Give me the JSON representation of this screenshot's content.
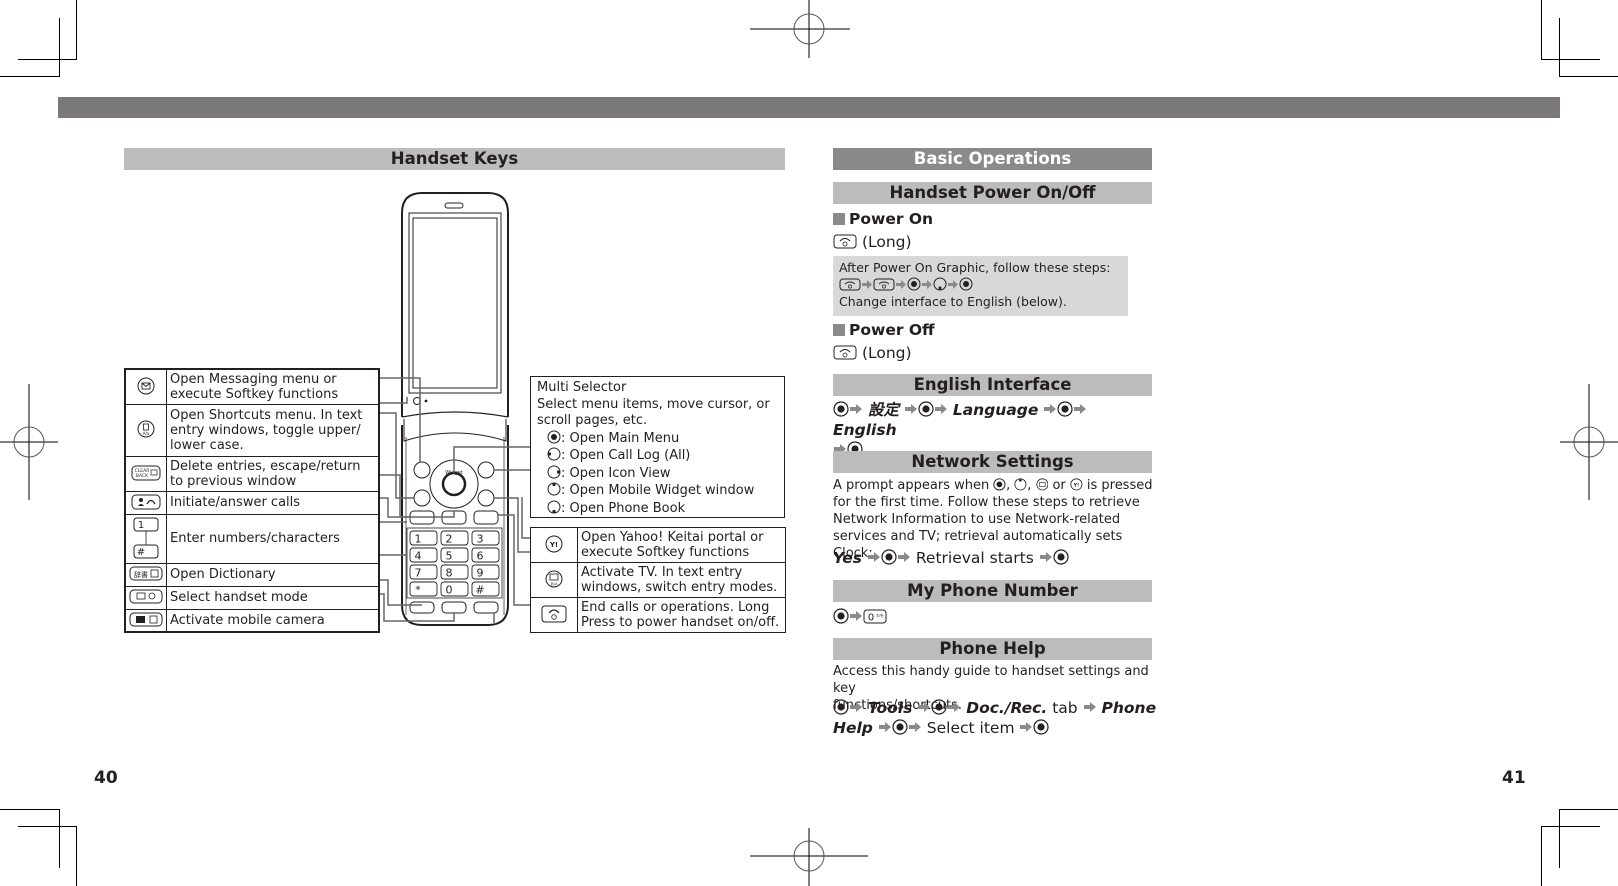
{
  "page_numbers": {
    "left": "40",
    "right": "41"
  },
  "left_page": {
    "section_title": "Handset Keys",
    "left_callouts": [
      {
        "icon": "mail-key-icon",
        "text": "Open Messaging menu or execute Softkey functions"
      },
      {
        "icon": "shortcut-key-icon",
        "text": "Open Shortcuts menu. In text entry windows, toggle upper/ lower case."
      },
      {
        "icon": "clear-back-key-icon",
        "text": "Delete entries, escape/return to previous window"
      },
      {
        "icon": "send-key-icon",
        "text": "Initiate/answer calls"
      },
      {
        "icon": "number-keys-icon",
        "text": "Enter numbers/characters"
      },
      {
        "icon": "dictionary-key-icon",
        "text": "Open Dictionary"
      },
      {
        "icon": "mode-key-icon",
        "text": "Select handset mode"
      },
      {
        "icon": "camera-key-icon",
        "text": "Activate mobile camera"
      }
    ],
    "multi_selector": {
      "title": "Multi Selector",
      "description": "Select menu items, move cursor, or scroll pages, etc.",
      "items": [
        {
          "icon": "selector-center-icon",
          "text": ": Open Main Menu"
        },
        {
          "icon": "selector-left-icon",
          "text": ": Open Call Log (All)"
        },
        {
          "icon": "selector-right-icon",
          "text": ": Open Icon View"
        },
        {
          "icon": "selector-up-icon",
          "text": ": Open Mobile Widget window"
        },
        {
          "icon": "selector-down-icon",
          "text": ": Open Phone Book"
        }
      ]
    },
    "right_callouts": [
      {
        "icon": "yahoo-key-icon",
        "text": "Open Yahoo! Keitai portal or execute Softkey functions"
      },
      {
        "icon": "tv-key-icon",
        "text": "Activate TV. In text entry windows, switch entry modes."
      },
      {
        "icon": "end-power-key-icon",
        "text": "End calls or operations. Long Press to power handset on/off."
      }
    ],
    "phone_labels": {
      "widget": "Widget",
      "keys": [
        "1",
        "2",
        "3",
        "4",
        "5",
        "6",
        "7",
        "8",
        "9",
        "*",
        "0",
        "#"
      ]
    }
  },
  "right_page": {
    "section_title": "Basic Operations",
    "power": {
      "title": "Handset Power On/Off",
      "on_label": "Power On",
      "on_step": "(Long)",
      "note_line1": "After Power On Graphic, follow these steps:",
      "note_line3": "Change interface to English (below).",
      "off_label": "Power Off",
      "off_step": "(Long)"
    },
    "english": {
      "title": "English Interface",
      "step_settei": "設定",
      "step_language": "Language",
      "step_english": "English"
    },
    "network": {
      "title": "Network Settings",
      "p1": "A prompt appears when",
      "p1b": ",",
      "p1c": ",",
      "p1d": "or",
      "p1e": "is pressed",
      "p2": "for the first time. Follow these steps to retrieve",
      "p3": "Network Information to use Network-related",
      "p4": "services and TV; retrieval automatically sets Clock:",
      "step_yes": "Yes",
      "step_retrieval": "Retrieval starts"
    },
    "my_number": {
      "title": "My Phone Number"
    },
    "help": {
      "title": "Phone Help",
      "p1": "Access this handy guide to handset settings and key",
      "p2": "functions/shortcuts.",
      "step_tools": "Tools",
      "step_docrec": "Doc./Rec.",
      "step_tab": "tab",
      "step_phone": "Phone",
      "step_help": "Help",
      "step_select": "Select item"
    }
  },
  "colors": {
    "dark_header": "#8a8a8a",
    "light_header": "#bcbcbc",
    "top_bar": "#7a7878",
    "note_bg": "#d8d8d8"
  }
}
